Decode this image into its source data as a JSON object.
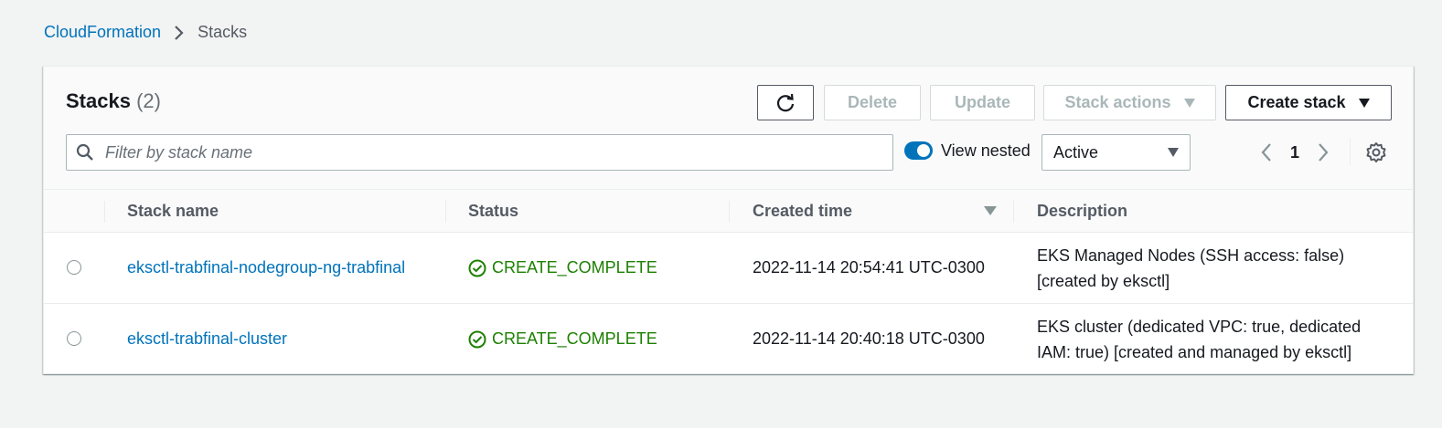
{
  "breadcrumb": {
    "root": "CloudFormation",
    "current": "Stacks"
  },
  "panel": {
    "title": "Stacks",
    "count": "(2)"
  },
  "toolbar": {
    "delete_label": "Delete",
    "update_label": "Update",
    "stack_actions_label": "Stack actions",
    "create_stack_label": "Create stack"
  },
  "filter": {
    "placeholder": "Filter by stack name",
    "view_nested_label": "View nested",
    "view_nested_on": true,
    "status_selected": "Active"
  },
  "pagination": {
    "page": "1"
  },
  "table": {
    "columns": {
      "stack_name": "Stack name",
      "status": "Status",
      "created_time": "Created time",
      "description": "Description"
    },
    "rows": [
      {
        "stack_name": "eksctl-trabfinal-nodegroup-ng-trabfinal",
        "status": "CREATE_COMPLETE",
        "created_time": "2022-11-14 20:54:41 UTC-0300",
        "description": "EKS Managed Nodes (SSH access: false) [created by eksctl]"
      },
      {
        "stack_name": "eksctl-trabfinal-cluster",
        "status": "CREATE_COMPLETE",
        "created_time": "2022-11-14 20:40:18 UTC-0300",
        "description": "EKS cluster (dedicated VPC: true, dedicated IAM: true) [created and managed by eksctl]"
      }
    ]
  },
  "colors": {
    "link": "#0073bb",
    "success": "#1d8102",
    "toggle_on": "#0073bb",
    "background": "#f2f3f3"
  },
  "icons": {
    "refresh": "refresh-icon",
    "search": "search-icon",
    "settings": "gear-icon",
    "breadcrumb_separator": "chevron-right-icon",
    "status": "check-circle-icon"
  }
}
